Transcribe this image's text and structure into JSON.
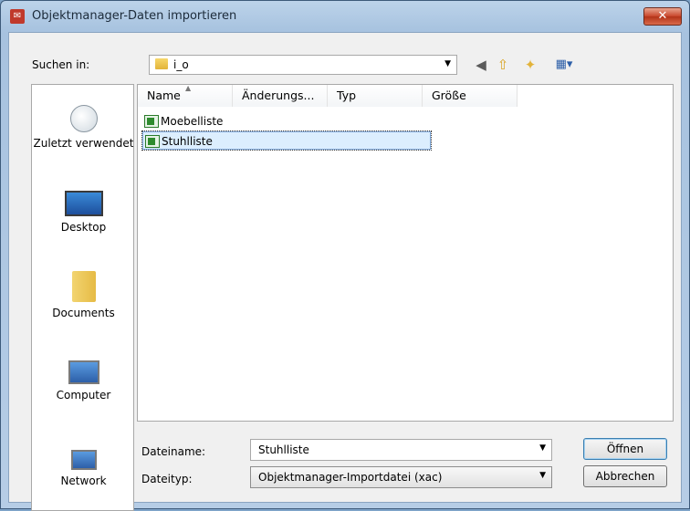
{
  "window": {
    "title": "Objektmanager-Daten importieren",
    "close_glyph": "✕"
  },
  "lookin": {
    "label": "Suchen in:",
    "value": "i_o"
  },
  "places": [
    {
      "label": "Zuletzt verwendet",
      "icon": "recent-places-icon"
    },
    {
      "label": "Desktop",
      "icon": "desktop-icon"
    },
    {
      "label": "Documents",
      "icon": "documents-folder-icon"
    },
    {
      "label": "Computer",
      "icon": "computer-icon"
    },
    {
      "label": "Network",
      "icon": "network-icon"
    }
  ],
  "filelist": {
    "columns": [
      "Name",
      "Änderungs...",
      "Typ",
      "Größe"
    ],
    "rows": [
      {
        "name": "Moebelliste",
        "selected": false
      },
      {
        "name": "Stuhlliste",
        "selected": true
      }
    ]
  },
  "filename": {
    "label": "Dateiname:",
    "value": "Stuhlliste"
  },
  "filetype": {
    "label": "Dateityp:",
    "value": "Objektmanager-Importdatei (xac)"
  },
  "buttons": {
    "open": "Öffnen",
    "cancel": "Abbrechen"
  },
  "colors": {
    "titlebar": "#bcd3ea",
    "selection": "#dceefe",
    "close_button": "#c8452a"
  }
}
